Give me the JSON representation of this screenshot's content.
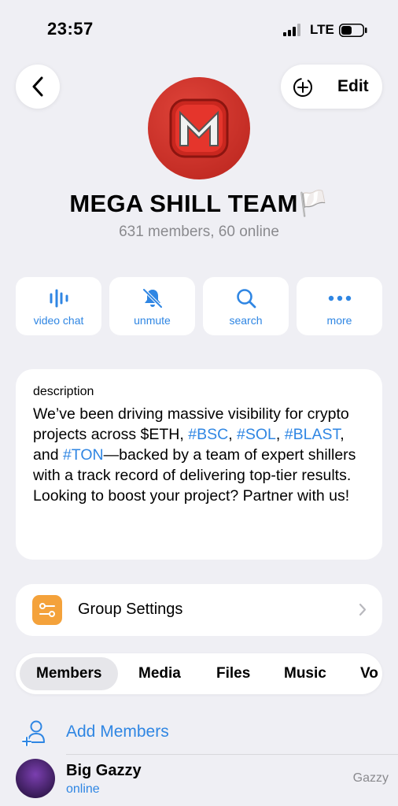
{
  "status_bar": {
    "time": "23:57",
    "network": "LTE"
  },
  "header": {
    "edit_label": "Edit"
  },
  "profile": {
    "title": "MEGA SHILL TEAM🏳️",
    "subtitle": "631 members, 60 online"
  },
  "actions": [
    {
      "label": "video chat",
      "icon": "waveform-icon"
    },
    {
      "label": "unmute",
      "icon": "bell-slash-icon"
    },
    {
      "label": "search",
      "icon": "search-icon"
    },
    {
      "label": "more",
      "icon": "ellipsis-icon"
    }
  ],
  "description": {
    "label": "description",
    "parts": [
      "We’ve been driving massive visibility for crypto projects across $ETH, ",
      "#BSC",
      ", ",
      "#SOL",
      ", ",
      "#BLAST",
      ", and ",
      "#TON",
      "—backed by a team of expert shillers with a track record of delivering top-tier results. Looking to boost your project? Partner with us!"
    ]
  },
  "settings": {
    "label": "Group Settings"
  },
  "tabs": [
    "Members",
    "Media",
    "Files",
    "Music",
    "Vo"
  ],
  "add_members": {
    "label": "Add Members"
  },
  "members": [
    {
      "name": "Big Gazzy",
      "status": "online",
      "role": "Gazzy"
    }
  ],
  "colors": {
    "accent": "#2f86e3",
    "settings_icon_bg": "#f4a23b",
    "background": "#efeff4"
  }
}
